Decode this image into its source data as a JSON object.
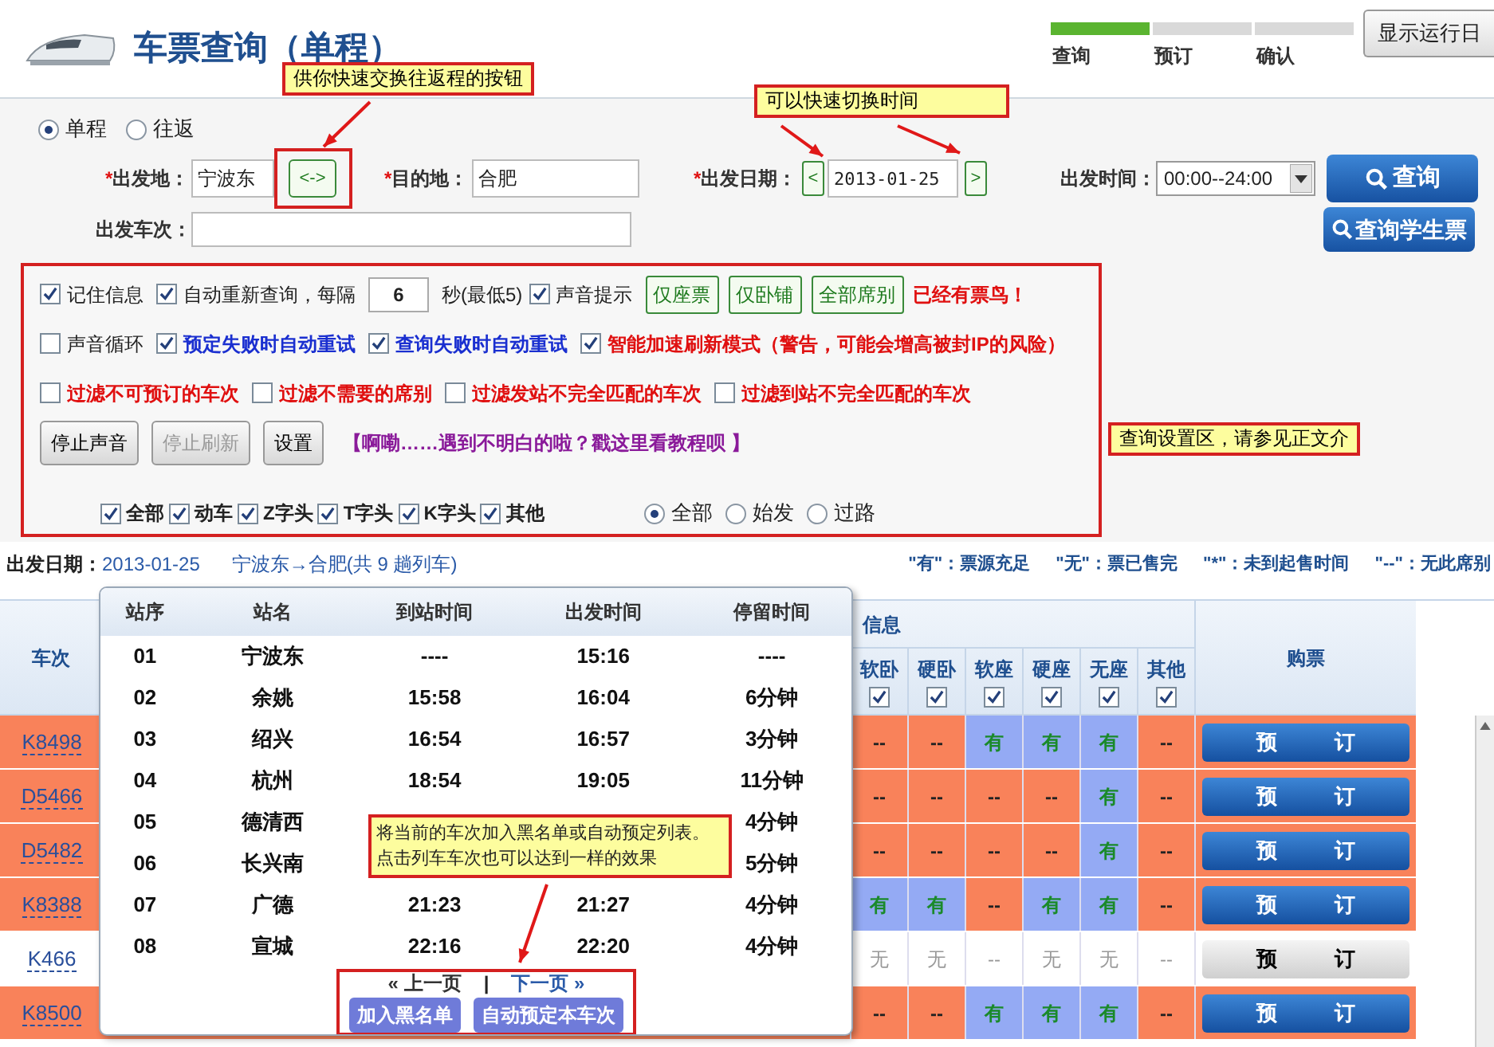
{
  "header": {
    "title": "车票查询（单程）",
    "steps": [
      {
        "label": "查询",
        "selected": true
      },
      {
        "label": "预订",
        "selected": false
      },
      {
        "label": "确认",
        "selected": false
      }
    ],
    "log_button": "显示运行日"
  },
  "trip_type": [
    {
      "label": "单程",
      "selected": true
    },
    {
      "label": "往返",
      "selected": false
    }
  ],
  "search": {
    "from_label": "*出发地：",
    "from": "宁波东",
    "swap": "<->",
    "to_label": "*目的地：",
    "to": "合肥",
    "date_label": "*出发日期：",
    "prev": "<",
    "date": "2013-01-25",
    "next": ">",
    "time_label": "出发时间：",
    "time": "00:00--24:00",
    "query": "查询",
    "train_label": "出发车次：",
    "student_query": "查询学生票"
  },
  "settings": {
    "rows": [
      {
        "items": [
          {
            "kind": "checkbox",
            "label": "记住信息",
            "checked": true
          },
          {
            "kind": "checkbox",
            "label": "自动重新查询，每隔",
            "checked": true
          },
          {
            "kind": "number",
            "value": "6"
          },
          {
            "kind": "text",
            "text": "秒(最低5)"
          },
          {
            "kind": "checkbox",
            "label": "声音提示",
            "checked": true
          },
          {
            "kind": "button",
            "label": "仅座票"
          },
          {
            "kind": "button",
            "label": "仅卧铺"
          },
          {
            "kind": "button",
            "label": "全部席别"
          },
          {
            "kind": "alert",
            "text": "已经有票鸟！"
          }
        ]
      },
      {
        "items": [
          {
            "kind": "checkbox",
            "label": "声音循环",
            "checked": false
          },
          {
            "kind": "checkbox",
            "label": "预定失败时自动重试",
            "checked": true,
            "color": "#1a2fd0"
          },
          {
            "kind": "checkbox",
            "label": "查询失败时自动重试",
            "checked": true,
            "color": "#1a2fd0"
          },
          {
            "kind": "checkbox",
            "label": "智能加速刷新模式（警告，可能会增高被封IP的风险）",
            "checked": true,
            "color": "#e01010"
          }
        ]
      },
      {
        "items": [
          {
            "kind": "checkbox",
            "label": "过滤不可预订的车次",
            "checked": false,
            "color": "#e01010"
          },
          {
            "kind": "checkbox",
            "label": "过滤不需要的席别",
            "checked": false,
            "color": "#e01010"
          },
          {
            "kind": "checkbox",
            "label": "过滤发站不完全匹配的车次",
            "checked": false,
            "color": "#e01010"
          },
          {
            "kind": "checkbox",
            "label": "过滤到站不完全匹配的车次",
            "checked": false,
            "color": "#e01010"
          }
        ]
      },
      {
        "items": [
          {
            "kind": "gray_button",
            "label": "停止声音",
            "disabled": false
          },
          {
            "kind": "gray_button",
            "label": "停止刷新",
            "disabled": true
          },
          {
            "kind": "gray_button",
            "label": "设置",
            "disabled": false
          },
          {
            "kind": "link",
            "text": "【啊嘞……遇到不明白的啦？戳这里看教程呗 】"
          }
        ]
      }
    ],
    "train_types": [
      {
        "label": "全部",
        "checked": true
      },
      {
        "label": "动车",
        "checked": true
      },
      {
        "label": "Z字头",
        "checked": true
      },
      {
        "label": "T字头",
        "checked": true
      },
      {
        "label": "K字头",
        "checked": true
      },
      {
        "label": "其他",
        "checked": true
      }
    ],
    "station_filter": [
      {
        "label": "全部",
        "selected": true
      },
      {
        "label": "始发",
        "selected": false
      },
      {
        "label": "过路",
        "selected": false
      }
    ]
  },
  "summary": {
    "label": "出发日期：",
    "date": "2013-01-25",
    "route": "宁波东→合肥(共 9 趟列车)",
    "legend": [
      "\"有\"：票源充足",
      "\"无\"：票已售完",
      "\"*\"：未到起售时间",
      "\"--\"：无此席别"
    ]
  },
  "table": {
    "train_column": "车次",
    "group_column": "信息",
    "seat_columns": [
      {
        "label": "软卧",
        "checked": true
      },
      {
        "label": "硬卧",
        "checked": true
      },
      {
        "label": "软座",
        "checked": true
      },
      {
        "label": "硬座",
        "checked": true
      },
      {
        "label": "无座",
        "checked": true
      },
      {
        "label": "其他",
        "checked": true
      }
    ],
    "book_column": "购票",
    "rows": [
      {
        "train": "K8498",
        "highlighted": true,
        "book": "预 订",
        "book_enabled": true,
        "seats": [
          {
            "text": "--",
            "available": false
          },
          {
            "text": "--",
            "available": false
          },
          {
            "text": "有",
            "available": true
          },
          {
            "text": "有",
            "available": true
          },
          {
            "text": "有",
            "available": true
          },
          {
            "text": "--",
            "available": false
          }
        ]
      },
      {
        "train": "D5466",
        "highlighted": true,
        "book": "预 订",
        "book_enabled": true,
        "seats": [
          {
            "text": "--",
            "available": false
          },
          {
            "text": "--",
            "available": false
          },
          {
            "text": "--",
            "available": false
          },
          {
            "text": "--",
            "available": false
          },
          {
            "text": "有",
            "available": true
          },
          {
            "text": "--",
            "available": false
          }
        ]
      },
      {
        "train": "D5482",
        "highlighted": true,
        "book": "预 订",
        "book_enabled": true,
        "seats": [
          {
            "text": "--",
            "available": false
          },
          {
            "text": "--",
            "available": false
          },
          {
            "text": "--",
            "available": false
          },
          {
            "text": "--",
            "available": false
          },
          {
            "text": "有",
            "available": true
          },
          {
            "text": "--",
            "available": false
          }
        ]
      },
      {
        "train": "K8388",
        "highlighted": true,
        "book": "预 订",
        "book_enabled": true,
        "seats": [
          {
            "text": "有",
            "available": true
          },
          {
            "text": "有",
            "available": true
          },
          {
            "text": "--",
            "available": false
          },
          {
            "text": "有",
            "available": true
          },
          {
            "text": "有",
            "available": true
          },
          {
            "text": "--",
            "available": false
          }
        ]
      },
      {
        "train": "K466",
        "highlighted": false,
        "book": "预 订",
        "book_enabled": false,
        "seats": [
          {
            "text": "无",
            "available": false
          },
          {
            "text": "无",
            "available": false
          },
          {
            "text": "--",
            "available": false
          },
          {
            "text": "无",
            "available": false
          },
          {
            "text": "无",
            "available": false
          },
          {
            "text": "--",
            "available": false
          }
        ]
      },
      {
        "train": "K8500",
        "highlighted": true,
        "book": "预 订",
        "book_enabled": true,
        "seats": [
          {
            "text": "--",
            "available": false
          },
          {
            "text": "--",
            "available": false
          },
          {
            "text": "有",
            "available": true
          },
          {
            "text": "有",
            "available": true
          },
          {
            "text": "有",
            "available": true
          },
          {
            "text": "--",
            "available": false
          }
        ]
      }
    ]
  },
  "stops_popup": {
    "columns": [
      "站序",
      "站名",
      "到站时间",
      "出发时间",
      "停留时间"
    ],
    "rows": [
      {
        "no": "01",
        "station": "宁波东",
        "arrive": "----",
        "depart": "15:16",
        "stay": "----"
      },
      {
        "no": "02",
        "station": "余姚",
        "arrive": "15:58",
        "depart": "16:04",
        "stay": "6分钟"
      },
      {
        "no": "03",
        "station": "绍兴",
        "arrive": "16:54",
        "depart": "16:57",
        "stay": "3分钟"
      },
      {
        "no": "04",
        "station": "杭州",
        "arrive": "18:54",
        "depart": "19:05",
        "stay": "11分钟"
      },
      {
        "no": "05",
        "station": "德清西",
        "stay": "4分钟"
      },
      {
        "no": "06",
        "station": "长兴南",
        "stay": "5分钟"
      },
      {
        "no": "07",
        "station": "广德",
        "arrive": "21:23",
        "depart": "21:27",
        "stay": "4分钟"
      },
      {
        "no": "08",
        "station": "宣城",
        "arrive": "22:16",
        "depart": "22:20",
        "stay": "4分钟"
      }
    ],
    "prev_page": "« 上一页",
    "separator": "|",
    "next_page": "下一页 »",
    "blacklist": "加入黑名单",
    "auto_book": "自动预定本车次"
  },
  "annotations": {
    "swap_note": "供你快速交换往返程的按钮",
    "date_note": "可以快速切换时间",
    "settings_note": "查询设置区，请参见正文介",
    "popup_note": [
      "将当前的车次加入黑名单或自动预定列表。",
      "点击列车车次也可以达到一样的效果"
    ]
  }
}
